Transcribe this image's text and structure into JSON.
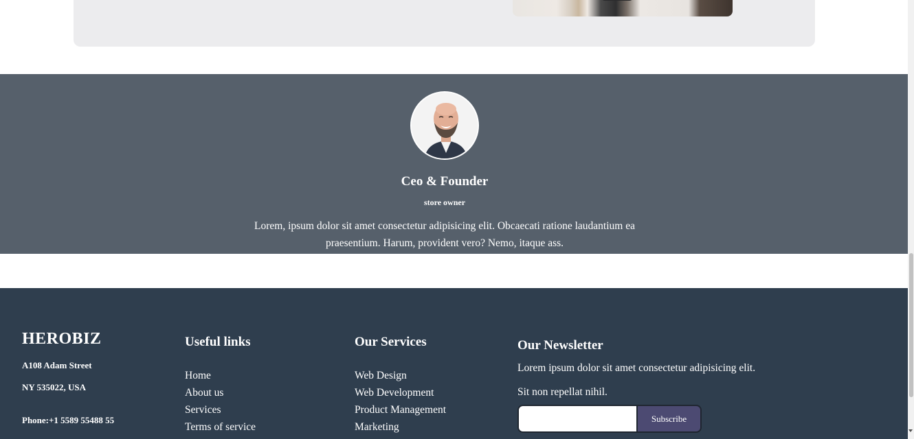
{
  "testimonial": {
    "title": "Ceo & Founder",
    "role": "store owner",
    "quote": "Lorem, ipsum dolor sit amet consectetur adipisicing elit. Obcaecati ratione laudantium ea praesentium. Harum, provident vero? Nemo, itaque ass."
  },
  "footer": {
    "brand": "HEROBIZ",
    "address_line1": "A108 Adam Street",
    "address_line2": "NY 535022, USA",
    "phone": "Phone:+1 5589 55488 55",
    "useful_links": {
      "title": "Useful links",
      "items": [
        "Home",
        "About us",
        "Services",
        "Terms of service"
      ]
    },
    "services": {
      "title": "Our Services",
      "items": [
        "Web Design",
        "Web Development",
        "Product Management",
        "Marketing"
      ]
    },
    "newsletter": {
      "title": "Our Newsletter",
      "text1": "Lorem ipsum dolor sit amet consectetur adipisicing elit.",
      "text2": "Sit non repellat nihil.",
      "input_value": "",
      "button_label": "Subscribe"
    }
  },
  "colors": {
    "testimonial_bg": "#56606b",
    "footer_bg": "#2f3e4e",
    "subscribe_button": "#4c4a72",
    "card_bg": "#ececee"
  }
}
